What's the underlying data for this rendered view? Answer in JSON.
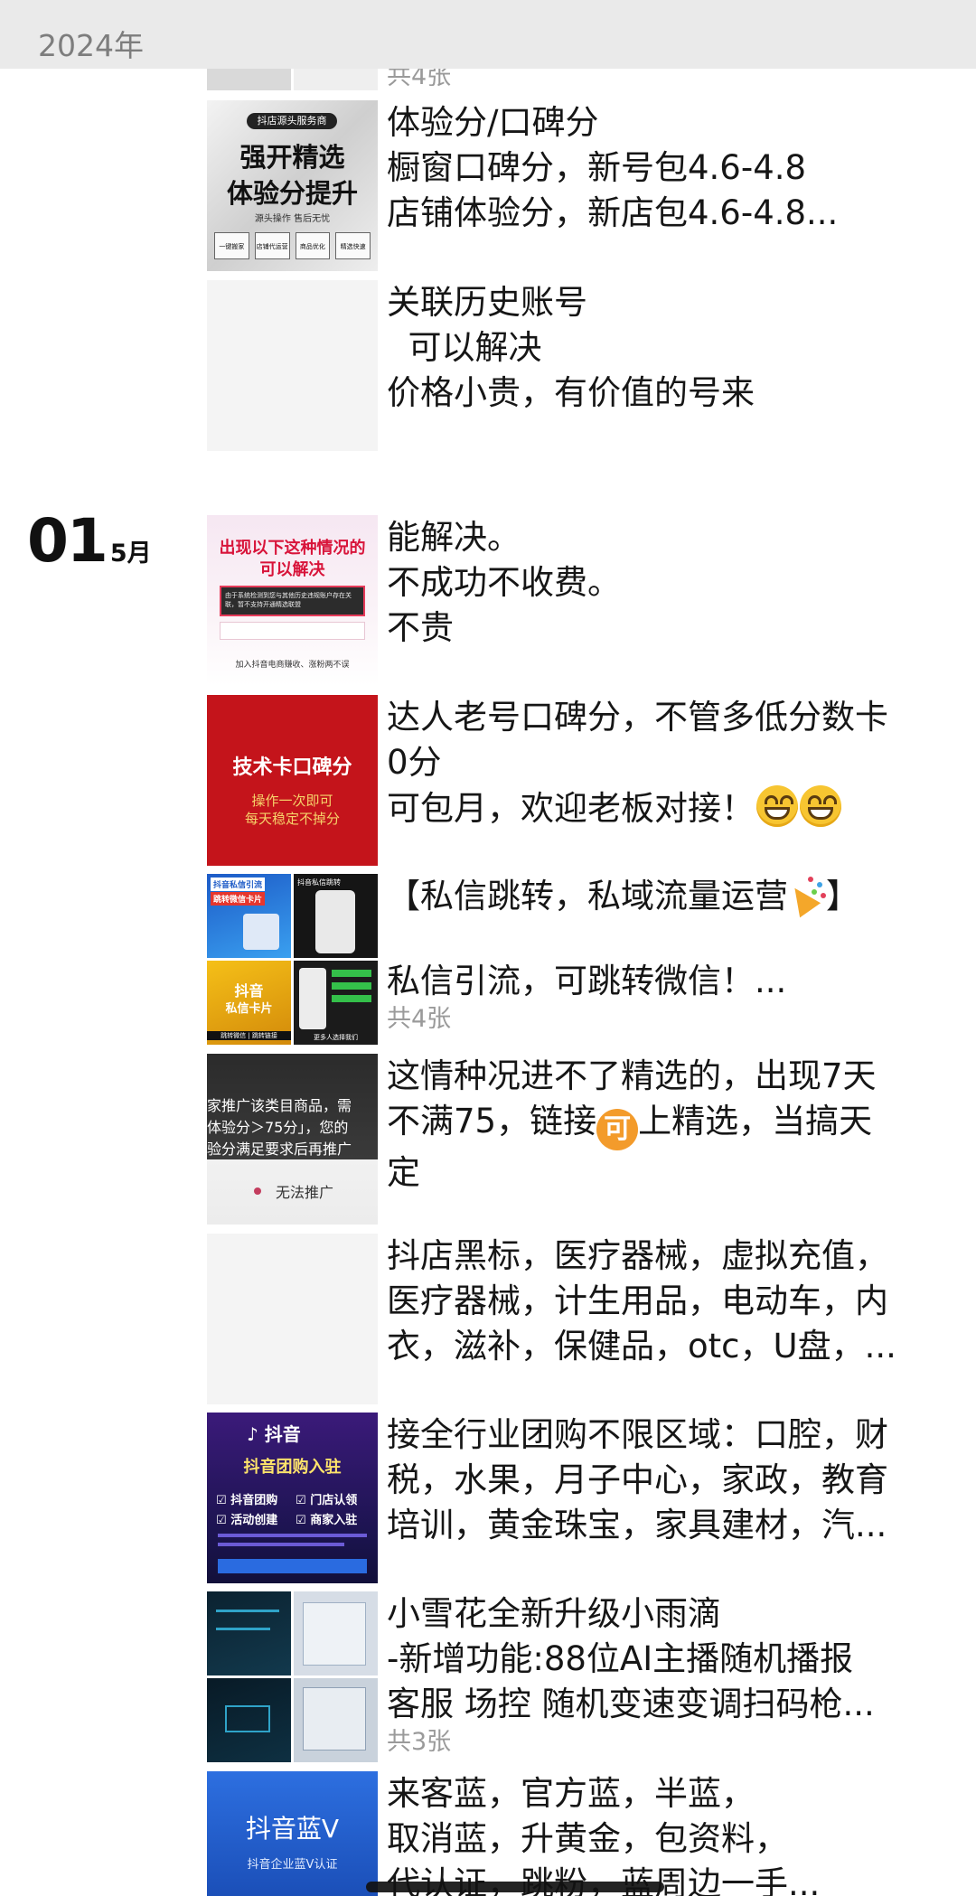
{
  "year_header": "2024年",
  "date_group": {
    "day": "01",
    "month": "5月"
  },
  "posts": [
    {
      "lines": [],
      "count": "共4张"
    },
    {
      "lines": [
        "体验分/口碑分",
        "橱窗口碑分，新号包4.6-4.8",
        "店铺体验分，新店包4.6-4.8..."
      ],
      "thumb_text": {
        "top": "抖店源头服务商",
        "main1": "强开精选",
        "main2": "体验分提升",
        "sub": "源头操作 售后无忧",
        "tags": [
          "一键搬家",
          "店铺代运营",
          "商品优化",
          "精选快速"
        ]
      }
    },
    {
      "lines": [
        "关联历史账号",
        "  可以解决",
        "价格小贵，有价值的号来"
      ]
    },
    {
      "lines": [
        "能解决。",
        "不成功不收费。",
        "不贵"
      ],
      "thumb_text": {
        "title1": "出现以下这种情况的",
        "title2": "可以解决",
        "body": "由于系统检测到您与其他历史违规账户存在关联，暂不支持开通精选联盟",
        "footer": "加入抖音电商赚收、涨粉两不误"
      }
    },
    {
      "lines": [
        "达人老号口碑分，不管多低分数卡",
        "0分",
        "可包月，欢迎老板对接！"
      ],
      "thumb_text": {
        "main": "技术卡口碑分",
        "sub1": "操作一次即可",
        "sub2": "每天稳定不掉分"
      }
    },
    {
      "lines": [
        "【私信跳转，私域流量运营",
        "】",
        "私信引流，可跳转微信！..."
      ],
      "count": "共4张",
      "thumb_text": {
        "a1": "抖音私信引流",
        "a2": "跳转微信卡片",
        "b1": "抖音私信跳转",
        "c1": "抖音",
        "c2": "私信卡片",
        "c3": "跳转微信 | 跳转链接",
        "d1": "更多人选择我们"
      }
    },
    {
      "lines": [
        "这情种况进不了精选的，出现7天",
        "不满75，链接",
        "上精选，当搞天",
        "定"
      ],
      "badge": "可",
      "thumb_text": {
        "l1": "家推广该类目商品，需",
        "l2": "体验分＞75分」，您的",
        "l3": "验分满足要求后再推广",
        "btn": "无法推广"
      }
    },
    {
      "lines": [
        "抖店黑标，医疗器械，虚拟充值，",
        "医疗器械，计生用品，电动车，内",
        "衣，滋补，保健品，otc，U盘，..."
      ]
    },
    {
      "lines": [
        "接全行业团购不限区域：口腔，财",
        "税，水果，月子中心，家政，教育",
        "培训，黄金珠宝，家具建材，汽..."
      ],
      "thumb_text": {
        "brand": "抖音",
        "title": "抖音团购入驻",
        "f1": "抖音团购",
        "f2": "门店认领",
        "f3": "活动创建",
        "f4": "商家入驻"
      }
    },
    {
      "lines": [
        "小雪花全新升级小雨滴",
        "-新增功能:88位AI主播随机播报",
        "客服 场控 随机变速变调扫码枪..."
      ],
      "count": "共3张"
    },
    {
      "lines": [
        "来客蓝，官方蓝，半蓝，",
        "取消蓝，升黄金，包资料，",
        "代认证，跳粉，蓝周边一手..."
      ],
      "thumb_text": {
        "main": "抖音蓝V",
        "sub": "抖音企业蓝V认证"
      }
    }
  ],
  "colors": {
    "header_bg": "#eaeaea",
    "count_gray": "#9a9a9a",
    "text": "#161616"
  }
}
